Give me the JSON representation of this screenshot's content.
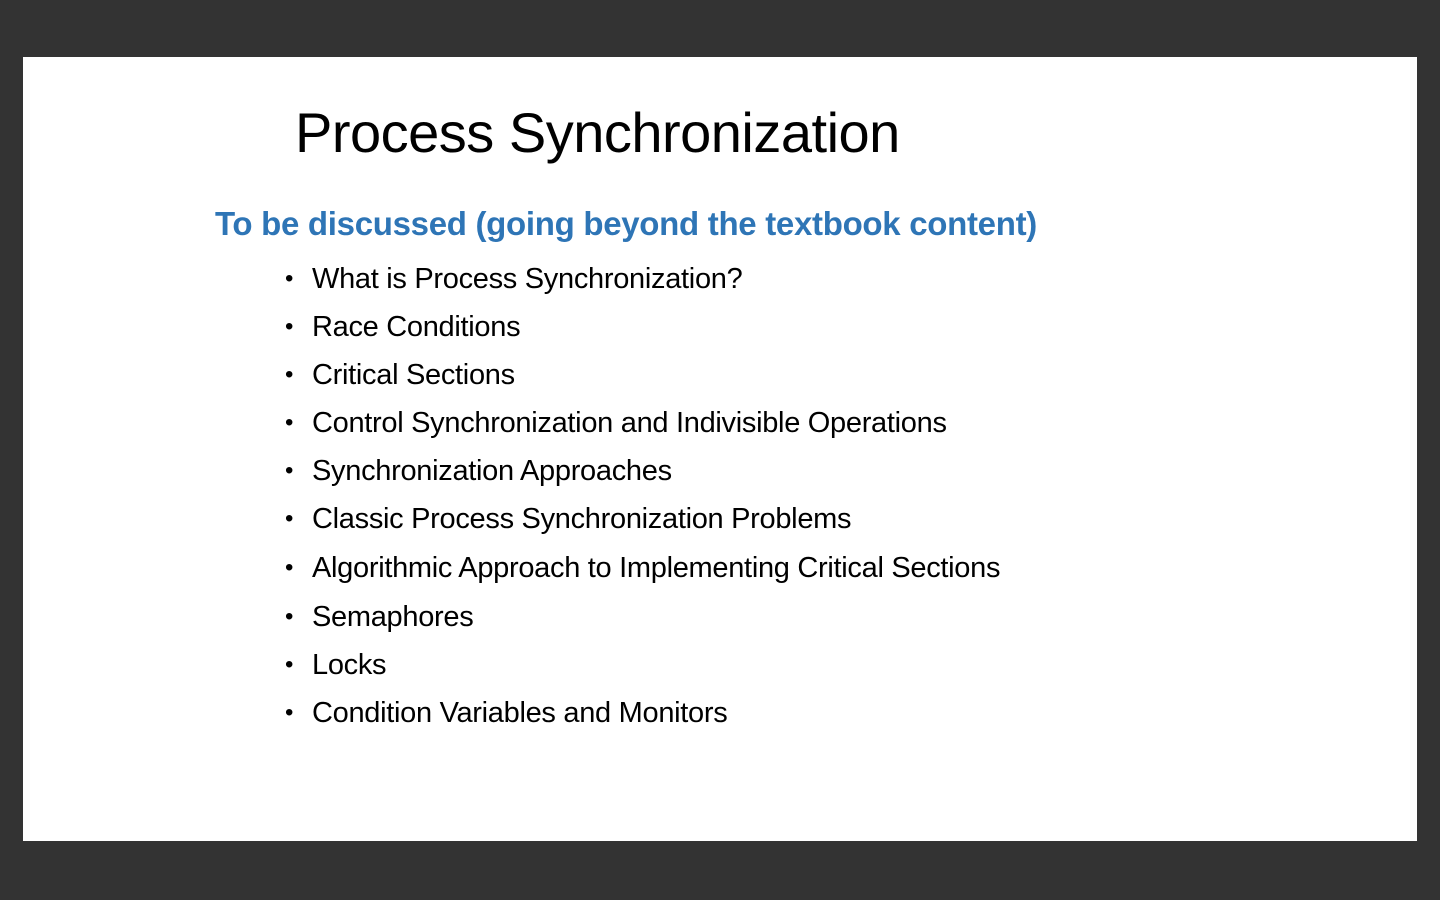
{
  "slide": {
    "title": "Process Synchronization",
    "subtitle": "To be discussed (going beyond the textbook content)",
    "bullet_symbol": "•",
    "items": [
      "What is Process Synchronization?",
      "Race Conditions",
      "Critical Sections",
      "Control Synchronization and Indivisible Operations",
      "Synchronization Approaches",
      "Classic Process Synchronization Problems",
      "Algorithmic Approach to Implementing Critical Sections",
      "Semaphores",
      "Locks",
      "Condition Variables and Monitors"
    ]
  },
  "colors": {
    "background": "#333333",
    "slide": "#ffffff",
    "title": "#000000",
    "subtitle": "#2e75b6",
    "body": "#000000"
  }
}
